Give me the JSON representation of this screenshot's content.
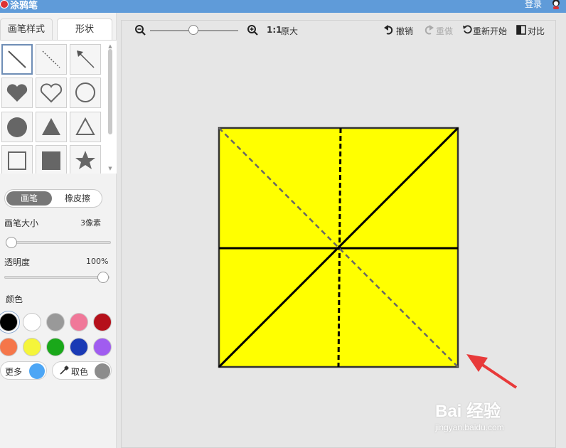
{
  "titlebar": {
    "app_title": "涂鸦笔",
    "login_label": "登录"
  },
  "tabs": [
    {
      "label": "画笔样式"
    },
    {
      "label": "形状"
    }
  ],
  "shapes": [
    {
      "icon": "line-icon",
      "selected": true
    },
    {
      "icon": "dashed-line-icon"
    },
    {
      "icon": "arrow-icon"
    },
    {
      "icon": "heart-filled-icon"
    },
    {
      "icon": "heart-outline-icon"
    },
    {
      "icon": "circle-outline-icon"
    },
    {
      "icon": "circle-filled-icon"
    },
    {
      "icon": "triangle-filled-icon"
    },
    {
      "icon": "triangle-outline-icon"
    },
    {
      "icon": "square-outline-icon"
    },
    {
      "icon": "square-filled-icon"
    },
    {
      "icon": "star-filled-icon"
    }
  ],
  "mode_toggle": {
    "pen_label": "画笔",
    "eraser_label": "橡皮擦"
  },
  "brush_size": {
    "label": "画笔大小",
    "value_text": "3像素",
    "level": 0.03
  },
  "opacity": {
    "label": "透明度",
    "value_text": "100%",
    "level": 1.0
  },
  "color_section": {
    "label": "颜色"
  },
  "colors": [
    "#000000",
    "#ffffff",
    "#999999",
    "#f07899",
    "#b5101a",
    "#f5764a",
    "#f5f53a",
    "#1aa81a",
    "#1a3ab5",
    "#a05cf0"
  ],
  "selected_color": "#000000",
  "more_colors": {
    "label": "更多",
    "color": "#4da6f5"
  },
  "color_picker": {
    "label": "取色",
    "color": "#8c8c8c"
  },
  "toolbar": {
    "zoom_ratio": "1:1",
    "original_size": "原大",
    "zoom_level": 0.5,
    "undo": "撤销",
    "redo": "重做",
    "restart": "重新开始",
    "compare": "对比"
  },
  "drawing": {
    "fill_color": "#ffff00",
    "stroke_color": "#000000",
    "dashed_color": "#666666"
  },
  "annotation": {
    "arrow_color": "#e83a3a"
  },
  "watermark": {
    "brand": "Bai 经验",
    "site": "jingyan.baidu.com"
  }
}
